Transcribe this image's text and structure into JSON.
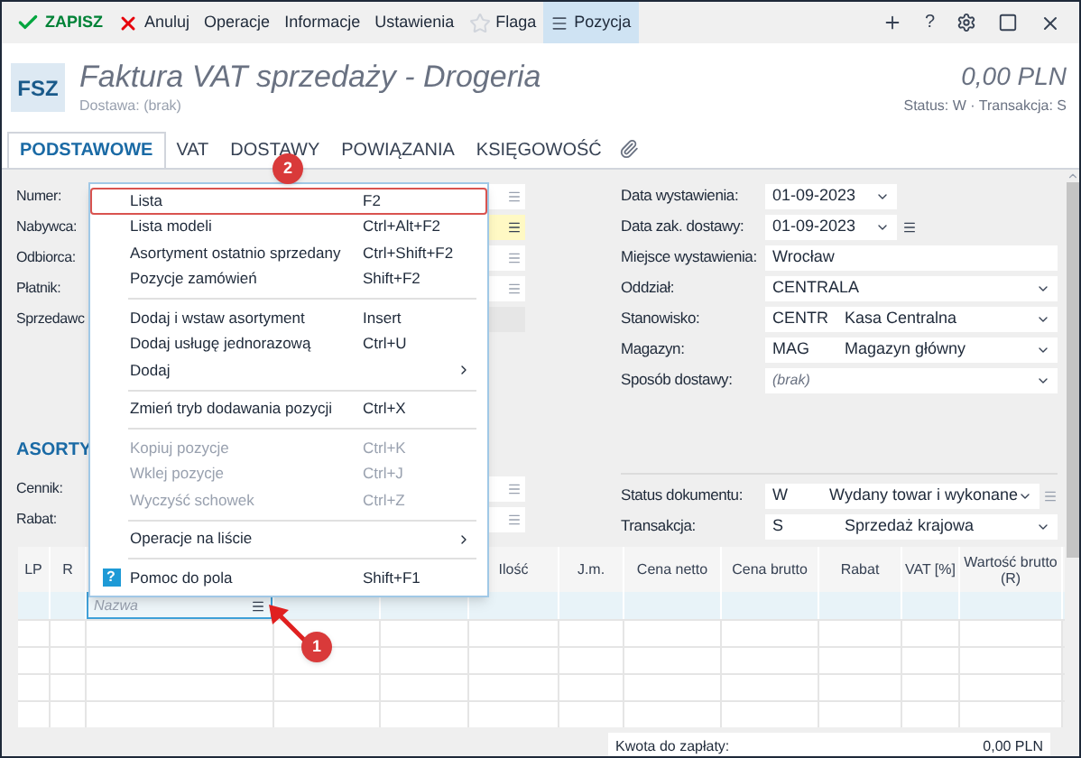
{
  "toolbar": {
    "items": [
      {
        "kind": "save",
        "label": "ZAPISZ",
        "selected": false
      },
      {
        "kind": "cancel",
        "label": "Anuluj",
        "selected": false
      },
      {
        "kind": "plain",
        "label": "Operacje",
        "selected": false
      },
      {
        "kind": "plain",
        "label": "Informacje",
        "selected": false
      },
      {
        "kind": "plain",
        "label": "Ustawienia",
        "selected": false
      },
      {
        "kind": "flag",
        "label": "Flaga",
        "selected": false
      },
      {
        "kind": "list",
        "label": "Pozycja",
        "selected": true
      }
    ],
    "help_button": "?"
  },
  "header": {
    "badge": "FSZ",
    "title": "Faktura VAT sprzedaży - Drogeria",
    "subtitle": "Dostawa: (brak)",
    "amount": "0,00 PLN",
    "status": "Status: W · Transakcja: S"
  },
  "tabs": [
    {
      "label": "PODSTAWOWE",
      "selected": true
    },
    {
      "label": "VAT",
      "selected": false
    },
    {
      "label": "DOSTAWY",
      "selected": false
    },
    {
      "label": "POWIĄZANIA",
      "selected": false
    },
    {
      "label": "KSIĘGOWOŚĆ",
      "selected": false
    }
  ],
  "left_fields": [
    {
      "label": "Numer:",
      "required": false,
      "list_button": true
    },
    {
      "label": "Nabywca:",
      "required": true,
      "list_button": true
    },
    {
      "label": "Odbiorca:",
      "required": false,
      "list_button": true
    },
    {
      "label": "Płatnik:",
      "required": false,
      "list_button": true
    },
    {
      "label": "Sprzedawc",
      "required": false,
      "list_button": false
    }
  ],
  "right_fields": [
    {
      "kind": "date",
      "label": "Data wystawienia:",
      "value": "01-09-2023",
      "list_button": false
    },
    {
      "kind": "date",
      "label": "Data zak. dostawy:",
      "value": "01-09-2023",
      "list_button": true
    },
    {
      "kind": "text",
      "label": "Miejsce wystawienia:",
      "value": "Wrocław"
    },
    {
      "kind": "select",
      "label": "Oddział:",
      "value": "CENTRALA"
    },
    {
      "kind": "select",
      "label": "Stanowisko:",
      "code": "CENTR",
      "value": "Kasa Centralna"
    },
    {
      "kind": "select",
      "label": "Magazyn:",
      "code": "MAG",
      "value": "Magazyn główny"
    },
    {
      "kind": "select",
      "label": "Sposób dostawy:",
      "placeholder": "(brak)"
    }
  ],
  "section_title": "ASORTY",
  "left_fields_2": [
    {
      "label": "Cennik:",
      "required": false,
      "list_button": true
    },
    {
      "label": "Rabat:",
      "required": false,
      "list_button": true
    }
  ],
  "right_fields_2": [
    {
      "kind": "select",
      "label": "Status dokumentu:",
      "code": "W",
      "value": "Wydany towar i wykonane",
      "list_button": true
    },
    {
      "kind": "select",
      "label": "Transakcja:",
      "code": "S",
      "value": "Sprzedaż krajowa",
      "list_button": false
    }
  ],
  "table": {
    "columns": [
      {
        "label": "LP"
      },
      {
        "label": "R"
      },
      {},
      {},
      {},
      {
        "label": "Ilość"
      },
      {
        "label": "J.m."
      },
      {
        "label": "Cena netto"
      },
      {
        "label": "Cena brutto"
      },
      {
        "label": "Rabat"
      },
      {
        "label": "VAT [%]"
      },
      {
        "label": "Wartość brutto (R)"
      }
    ],
    "edit_placeholder": "Nazwa"
  },
  "footer": {
    "label": "Kwota do zapłaty:",
    "value": "0,00 PLN"
  },
  "context_menu": [
    {
      "kind": "item",
      "label": "Lista",
      "shortcut": "F2",
      "disabled": false,
      "highlighted": true
    },
    {
      "kind": "item",
      "label": "Lista modeli",
      "shortcut": "Ctrl+Alt+F2",
      "disabled": false,
      "highlighted": false
    },
    {
      "kind": "item",
      "label": "Asortyment ostatnio sprzedany",
      "shortcut": "Ctrl+Shift+F2",
      "disabled": false,
      "highlighted": false
    },
    {
      "kind": "item",
      "label": "Pozycje zamówień",
      "shortcut": "Shift+F2",
      "disabled": false,
      "highlighted": false
    },
    {
      "kind": "separator"
    },
    {
      "kind": "item",
      "label": "Dodaj i wstaw asortyment",
      "shortcut": "Insert",
      "disabled": false,
      "highlighted": false
    },
    {
      "kind": "item",
      "label": "Dodaj usługę jednorazową",
      "shortcut": "Ctrl+U",
      "disabled": false,
      "highlighted": false
    },
    {
      "kind": "submenu",
      "label": "Dodaj",
      "disabled": false,
      "highlighted": false
    },
    {
      "kind": "separator"
    },
    {
      "kind": "item",
      "label": "Zmień tryb dodawania pozycji",
      "shortcut": "Ctrl+X",
      "disabled": false,
      "highlighted": false
    },
    {
      "kind": "separator"
    },
    {
      "kind": "item",
      "label": "Kopiuj pozycje",
      "shortcut": "Ctrl+K",
      "disabled": true,
      "highlighted": false
    },
    {
      "kind": "item",
      "label": "Wklej pozycje",
      "shortcut": "Ctrl+J",
      "disabled": true,
      "highlighted": false
    },
    {
      "kind": "item",
      "label": "Wyczyść schowek",
      "shortcut": "Ctrl+Z",
      "disabled": true,
      "highlighted": false
    },
    {
      "kind": "separator"
    },
    {
      "kind": "submenu",
      "label": "Operacje na liście",
      "disabled": false,
      "highlighted": false
    },
    {
      "kind": "separator"
    },
    {
      "kind": "help",
      "icon": "?",
      "label": "Pomoc do pola",
      "shortcut": "Shift+F1",
      "disabled": false,
      "highlighted": false
    }
  ],
  "annotations": [
    {
      "label": "2"
    },
    {
      "label": "1"
    }
  ]
}
